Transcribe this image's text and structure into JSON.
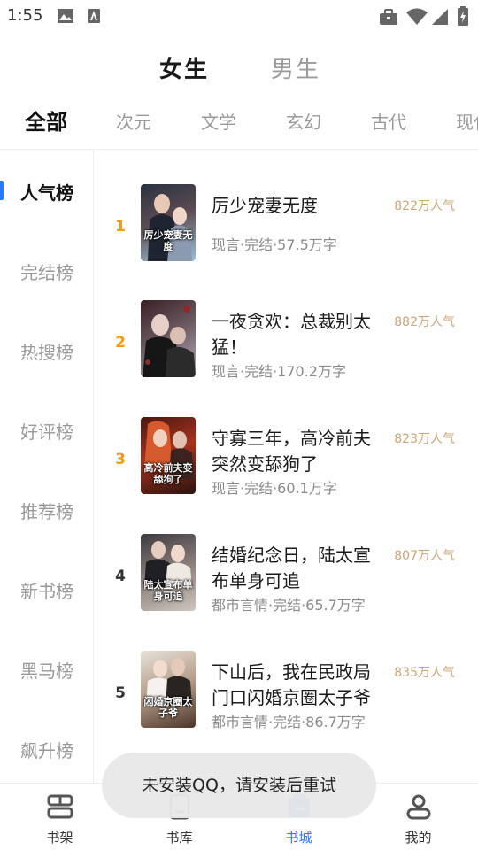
{
  "status_bar": {
    "time": "1:55"
  },
  "gender_tabs": [
    {
      "label": "女生",
      "active": true
    },
    {
      "label": "男生",
      "active": false
    }
  ],
  "category_tabs": [
    {
      "label": "全部",
      "active": true
    },
    {
      "label": "次元",
      "active": false
    },
    {
      "label": "文学",
      "active": false
    },
    {
      "label": "玄幻",
      "active": false
    },
    {
      "label": "古代",
      "active": false
    },
    {
      "label": "现代",
      "active": false
    }
  ],
  "side_nav": [
    {
      "label": "人气榜",
      "active": true
    },
    {
      "label": "完结榜",
      "active": false
    },
    {
      "label": "热搜榜",
      "active": false
    },
    {
      "label": "好评榜",
      "active": false
    },
    {
      "label": "推荐榜",
      "active": false
    },
    {
      "label": "新书榜",
      "active": false
    },
    {
      "label": "黑马榜",
      "active": false
    },
    {
      "label": "飙升榜",
      "active": false
    }
  ],
  "books": [
    {
      "rank": "1",
      "title": "厉少宠妻无度",
      "meta": "现言·完结·57.5万字",
      "popularity": "822万人气",
      "cover_text": "厉少宠妻无度"
    },
    {
      "rank": "2",
      "title": "一夜贪欢：总裁别太猛！",
      "meta": "现言·完结·170.2万字",
      "popularity": "882万人气",
      "cover_text": ""
    },
    {
      "rank": "3",
      "title": "守寡三年，高冷前夫突然变舔狗了",
      "meta": "现言·完结·60.1万字",
      "popularity": "823万人气",
      "cover_text": "高冷前夫变舔狗了"
    },
    {
      "rank": "4",
      "title": "结婚纪念日，陆太宣布单身可追",
      "meta": "都市言情·完结·65.7万字",
      "popularity": "807万人气",
      "cover_text": "陆太宣布单身可追"
    },
    {
      "rank": "5",
      "title": "下山后，我在民政局门口闪婚京圈太子爷",
      "meta": "都市言情·完结·86.7万字",
      "popularity": "835万人气",
      "cover_text": "闪婚京圈太子爷"
    }
  ],
  "bottom_nav": [
    {
      "label": "书架",
      "icon": "bookshelf-icon",
      "active": false
    },
    {
      "label": "书库",
      "icon": "library-icon",
      "active": false
    },
    {
      "label": "书城",
      "icon": "bookstore-icon",
      "active": true
    },
    {
      "label": "我的",
      "icon": "profile-icon",
      "active": false
    }
  ],
  "toast": {
    "message": "未安装QQ，请安装后重试"
  },
  "colors": {
    "accent": "#2979ff",
    "rank_top": "#f39c12",
    "popularity": "#c9a67a"
  }
}
